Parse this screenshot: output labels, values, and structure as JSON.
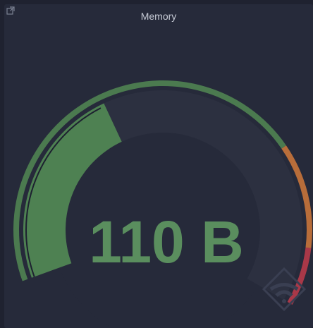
{
  "panel": {
    "title": "Memory",
    "link_icon": "external-link-icon"
  },
  "gauge": {
    "value_text": "110 B",
    "value_fraction": 0.49,
    "thresholds": [
      {
        "from": 0.0,
        "to": 0.72,
        "color": "#4b7a4f"
      },
      {
        "from": 0.72,
        "to": 0.9,
        "color": "#b86d3a"
      },
      {
        "from": 0.9,
        "to": 1.0,
        "color": "#a93848"
      }
    ],
    "fill_color": "#4e8152",
    "track_color": "#2c3040",
    "text_color": "#5a8e5e"
  },
  "watermark_icon": "grafana-logo-icon"
}
